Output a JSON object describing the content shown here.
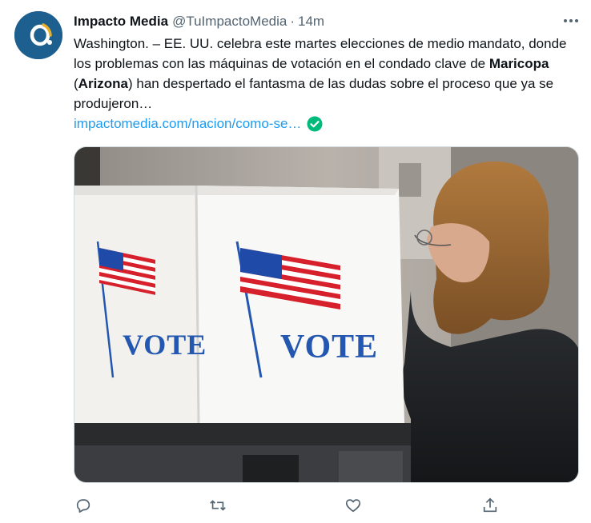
{
  "account": {
    "name": "Impacto Media",
    "handle": "@TuImpactoMedia",
    "separator": "·",
    "time": "14m"
  },
  "tweet": {
    "text_part1": "Washington. – EE. UU. celebra este martes elecciones de medio mandato, donde los problemas con las máquinas de votación en el condado clave de ",
    "text_bold1": "Maricopa",
    "text_part2": " (",
    "text_bold2": "Arizona",
    "text_part3": ") han despertado el fantasma de las dudas sobre el proceso que ya se produjeron…",
    "link": "impactomedia.com/nacion/como-se…"
  },
  "media": {
    "booth_label_left": "VOTE",
    "booth_label_right": "VOTE"
  },
  "actions": [
    {
      "name": "reply-icon"
    },
    {
      "name": "retweet-icon"
    },
    {
      "name": "like-icon"
    },
    {
      "name": "share-icon"
    }
  ],
  "colors": {
    "accent": "#1d9bf0",
    "avatar_bg": "#1d5f8e",
    "verified": "#00ba7c",
    "muted": "#536471"
  }
}
